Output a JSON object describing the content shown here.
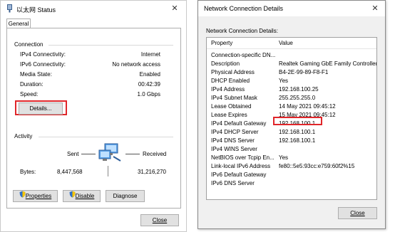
{
  "status_window": {
    "title": "以太网 Status",
    "close_glyph": "✕",
    "tab_general": "General",
    "connection_header": "Connection",
    "rows": [
      {
        "label": "IPv4 Connectivity:",
        "value": "Internet"
      },
      {
        "label": "IPv6 Connectivity:",
        "value": "No network access"
      },
      {
        "label": "Media State:",
        "value": "Enabled"
      },
      {
        "label": "Duration:",
        "value": "00:42:39"
      },
      {
        "label": "Speed:",
        "value": "1.0 Gbps"
      }
    ],
    "details_button": "Details...",
    "activity_header": "Activity",
    "sent_label": "Sent",
    "received_label": "Received",
    "bytes_label": "Bytes:",
    "bytes_sent": "8,447,568",
    "bytes_received": "31,216,270",
    "properties_button": "Properties",
    "disable_button": "Disable",
    "diagnose_button": "Diagnose",
    "close_button": "Close"
  },
  "details_window": {
    "title": "Network Connection Details",
    "close_glyph": "✕",
    "section_label": "Network Connection Details:",
    "col_property": "Property",
    "col_value": "Value",
    "rows": [
      {
        "p": "Connection-specific DN...",
        "v": ""
      },
      {
        "p": "Description",
        "v": "Realtek Gaming GbE Family Controller"
      },
      {
        "p": "Physical Address",
        "v": "B4-2E-99-89-F8-F1"
      },
      {
        "p": "DHCP Enabled",
        "v": "Yes"
      },
      {
        "p": "IPv4 Address",
        "v": "192.168.100.25"
      },
      {
        "p": "IPv4 Subnet Mask",
        "v": "255.255.255.0"
      },
      {
        "p": "Lease Obtained",
        "v": "14 May 2021 09:45:12"
      },
      {
        "p": "Lease Expires",
        "v": "15 May 2021 09:45:12"
      },
      {
        "p": "IPv4 Default Gateway",
        "v": "192.168.100.1"
      },
      {
        "p": "IPv4 DHCP Server",
        "v": "192.168.100.1"
      },
      {
        "p": "IPv4 DNS Server",
        "v": "192.168.100.1"
      },
      {
        "p": "IPv4 WINS Server",
        "v": ""
      },
      {
        "p": "NetBIOS over Tcpip En...",
        "v": "Yes"
      },
      {
        "p": "Link-local IPv6 Address",
        "v": "fe80::5e5:93cc:e759:60f2%15"
      },
      {
        "p": "IPv6 Default Gateway",
        "v": ""
      },
      {
        "p": "IPv6 DNS Server",
        "v": ""
      }
    ],
    "close_button": "Close"
  },
  "colors": {
    "highlight_red": "#e0262a",
    "shield_blue": "#2f6fc9",
    "shield_yellow": "#f5c400"
  }
}
